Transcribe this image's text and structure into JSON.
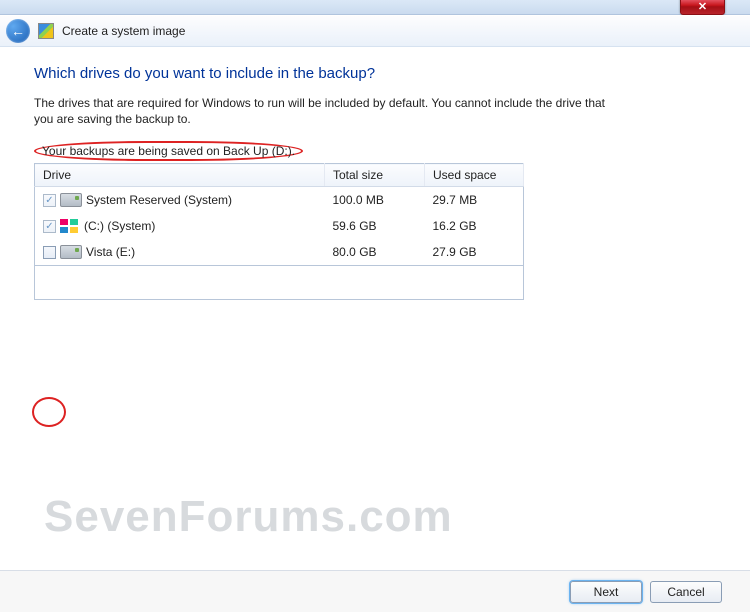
{
  "window": {
    "title": "Create a system image",
    "close_glyph": "✕"
  },
  "page": {
    "heading": "Which drives do you want to include in the backup?",
    "description": "The drives that are required for Windows to run will be included by default. You cannot include the drive that you are saving the backup to.",
    "save_note": "Your backups are being saved on Back Up (D:)."
  },
  "columns": {
    "drive": "Drive",
    "total": "Total size",
    "used": "Used space"
  },
  "drives": [
    {
      "checked": true,
      "locked": true,
      "icon": "hdd",
      "name": "System Reserved (System)",
      "total": "100.0 MB",
      "used": "29.7 MB"
    },
    {
      "checked": true,
      "locked": true,
      "icon": "win",
      "name": "(C:) (System)",
      "total": "59.6 GB",
      "used": "16.2 GB"
    },
    {
      "checked": false,
      "locked": false,
      "icon": "hdd",
      "name": "Vista (E:)",
      "total": "80.0 GB",
      "used": "27.9 GB"
    }
  ],
  "buttons": {
    "next": "Next",
    "cancel": "Cancel"
  },
  "watermark": "SevenForums.com"
}
